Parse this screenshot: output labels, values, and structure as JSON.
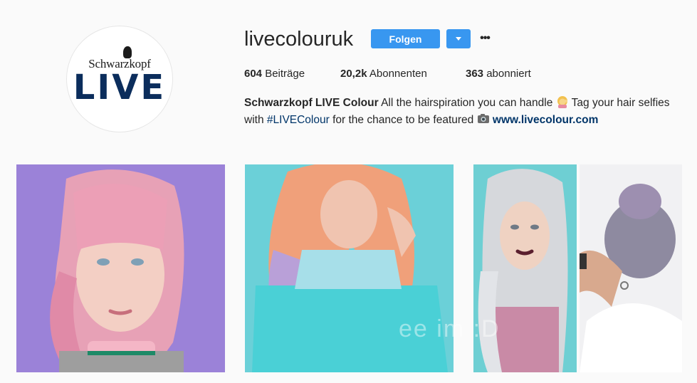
{
  "profile": {
    "avatar": {
      "brand_top": "Schwarzkopf",
      "brand_main": "LIVE"
    },
    "username": "livecolouruk",
    "follow_label": "Folgen",
    "more_label": "•••"
  },
  "stats": {
    "posts": {
      "count": "604",
      "label": "Beiträge"
    },
    "followers": {
      "count": "20,2k",
      "label": "Abonnenten"
    },
    "following": {
      "count": "363",
      "label": "abonniert"
    }
  },
  "bio": {
    "name": "Schwarzkopf LIVE Colour",
    "text1": "All the hairspiration you can handle",
    "text2": "Tag your hair selfies with",
    "hashtag": "#LIVEColour",
    "text3": "for the chance to be featured",
    "link": "www.livecolour.com",
    "emoji1": "woman-tipping-hand-emoji",
    "emoji2": "camera-emoji"
  },
  "posts": [
    {
      "name": "post-pink-hair-portrait"
    },
    {
      "name": "post-pastel-waves-teal-top"
    },
    {
      "name": "post-silver-hair-collage"
    }
  ],
  "watermark": "ee im :D",
  "colors": {
    "accent": "#3897f0",
    "link": "#003569",
    "text": "#262626",
    "background": "#fafafa"
  }
}
